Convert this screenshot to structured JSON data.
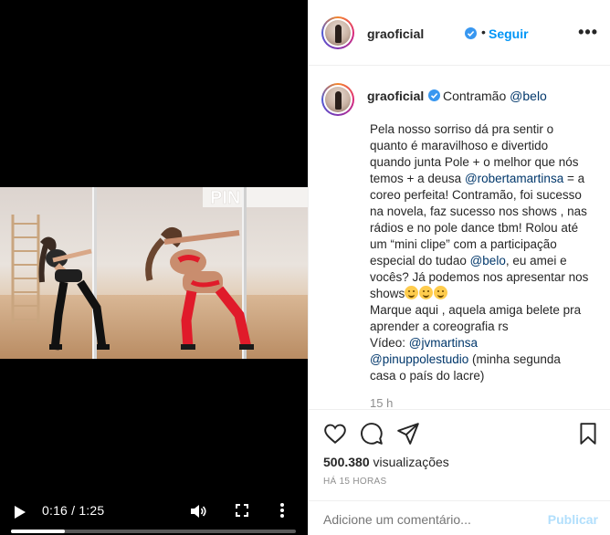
{
  "video": {
    "current_time": "0:16",
    "duration": "1:25",
    "time_display": "0:16 / 1:25",
    "progress_fraction": 0.19
  },
  "post": {
    "username": "graoficial",
    "separator": "•",
    "follow_label": "Seguir",
    "more_label": "•••",
    "caption": {
      "first_line": "Contramão",
      "first_mention": "@belo",
      "p1_a": "Pela nosso sorriso dá pra sentir o quanto é maravilhoso e divertido quando junta Pole + o melhor que nós temos + a deusa ",
      "p1_mention": "@robertamartinsa",
      "p1_b": " = a coreo perfeita! Contramão, foi sucesso na novela, faz sucesso nos shows , nas rádios e no pole dance tbm! Rolou até um “mini clipe” com a participação especial do tudao ",
      "p1_mention2": "@belo",
      "p1_c": ", eu amei e vocês? Já podemos nos apresentar nos shows",
      "p2": "Marque aqui , aquela amiga belete pra aprender a coreografia rs",
      "p3_a": "Vídeo: ",
      "p3_mention": "@jvmartinsa",
      "p4_mention": "@pinuppolestudio",
      "p4_b": " (minha segunda casa o país do lacre)",
      "time_ago": "15 h"
    },
    "views_count": "500.380",
    "views_label": "visualizações",
    "posted_ago": "HÁ 15 HORAS",
    "comment_placeholder": "Adicione um comentário...",
    "publish_label": "Publicar"
  },
  "colors": {
    "accent_blue": "#0095f6",
    "mention_blue": "#00376b",
    "muted": "#8e8e8e",
    "publish_disabled": "#b2dffc"
  },
  "icons": [
    "play-icon",
    "volume-icon",
    "fullscreen-icon",
    "more-vertical-icon",
    "verified-icon",
    "heart-icon",
    "comment-icon",
    "share-icon",
    "bookmark-icon"
  ]
}
